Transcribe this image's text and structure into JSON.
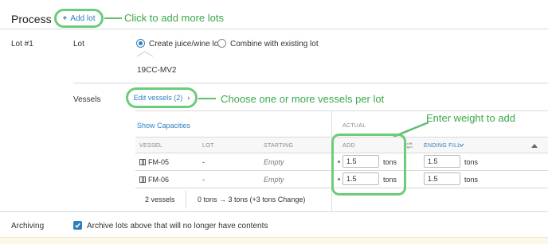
{
  "header": {
    "title": "Process to",
    "add_lot_label": "Add lot",
    "add_lot_icon": "+"
  },
  "annotations": {
    "add_lots": "Click to add more lots",
    "vessels": "Choose one or more vessels per lot",
    "weight": "Enter weight to add"
  },
  "lot": {
    "section_label": "Lot #1",
    "lot_label": "Lot",
    "options": [
      {
        "label": "Create juice/wine lot",
        "selected": true
      },
      {
        "label": "Combine with existing lot",
        "selected": false
      }
    ],
    "lot_code": "19CC-MV2"
  },
  "vessels": {
    "label": "Vessels",
    "edit_label": "Edit vessels (2)",
    "chevron": "›",
    "show_capacities": "Show Capacities",
    "actual_label": "ACTUAL",
    "columns": {
      "vessel": "VESSEL",
      "lot": "LOT",
      "starting": "STARTING",
      "add": "ADD",
      "ending_fill": "ENDING FILL"
    },
    "rows": [
      {
        "vessel": "FM-05",
        "lot": "-",
        "starting": "Empty",
        "add": "1.5",
        "add_unit": "tons",
        "ending": "1.5",
        "ending_unit": "tons"
      },
      {
        "vessel": "FM-06",
        "lot": "-",
        "starting": "Empty",
        "add": "1.5",
        "add_unit": "tons",
        "ending": "1.5",
        "ending_unit": "tons"
      }
    ],
    "summary_count": "2 vessels",
    "summary_change": "0 tons → 3 tons (+3 tons Change)"
  },
  "archiving": {
    "label": "Archiving",
    "checkbox_label": "Archive lots above that will no longer have contents",
    "checked": true
  },
  "colors": {
    "annotation_green": "#3aa94a",
    "link_blue": "#2f7fbf"
  }
}
